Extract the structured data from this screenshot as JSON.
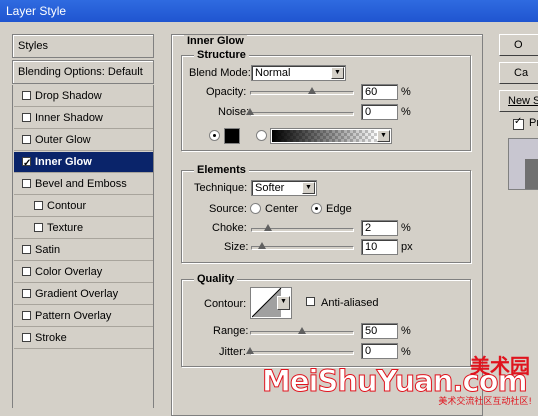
{
  "window": {
    "title": "Layer Style"
  },
  "left_panel": {
    "styles_label": "Styles",
    "blending_label": "Blending Options: Default",
    "items": [
      {
        "label": "Drop Shadow",
        "checked": false,
        "indent": false
      },
      {
        "label": "Inner Shadow",
        "checked": false,
        "indent": false
      },
      {
        "label": "Outer Glow",
        "checked": false,
        "indent": false
      },
      {
        "label": "Inner Glow",
        "checked": true,
        "indent": false,
        "selected": true
      },
      {
        "label": "Bevel and Emboss",
        "checked": false,
        "indent": false
      },
      {
        "label": "Contour",
        "checked": false,
        "indent": true
      },
      {
        "label": "Texture",
        "checked": false,
        "indent": true
      },
      {
        "label": "Satin",
        "checked": false,
        "indent": false
      },
      {
        "label": "Color Overlay",
        "checked": false,
        "indent": false
      },
      {
        "label": "Gradient Overlay",
        "checked": false,
        "indent": false
      },
      {
        "label": "Pattern Overlay",
        "checked": false,
        "indent": false
      },
      {
        "label": "Stroke",
        "checked": false,
        "indent": false
      }
    ]
  },
  "inner_glow": {
    "title": "Inner Glow",
    "structure": {
      "title": "Structure",
      "blend_mode_label": "Blend Mode:",
      "blend_mode_value": "Normal",
      "opacity_label": "Opacity:",
      "opacity_value": "60",
      "opacity_unit": "%",
      "opacity_level": 0.6,
      "noise_label": "Noise:",
      "noise_value": "0",
      "noise_unit": "%",
      "noise_level": 0,
      "color_swatch": "#000000"
    },
    "elements": {
      "title": "Elements",
      "technique_label": "Technique:",
      "technique_value": "Softer",
      "source_label": "Source:",
      "source_center": "Center",
      "source_edge": "Edge",
      "choke_label": "Choke:",
      "choke_value": "2",
      "choke_unit": "%",
      "choke_level": 0.02,
      "size_label": "Size:",
      "size_value": "10",
      "size_unit": "px",
      "size_level": 0.04
    },
    "quality": {
      "title": "Quality",
      "contour_label": "Contour:",
      "anti_aliased_label": "Anti-aliased",
      "range_label": "Range:",
      "range_value": "50",
      "range_unit": "%",
      "range_level": 0.5,
      "jitter_label": "Jitter:",
      "jitter_value": "0",
      "jitter_unit": "%",
      "jitter_level": 0
    }
  },
  "buttons": {
    "ok": "O",
    "cancel": "Ca",
    "new_style": "New S"
  },
  "preview_label": "Pr",
  "watermark": {
    "brand_cn": "美术园",
    "brand": "MeiShuYuan.com",
    "slogan": "美术交流社区互动社区!"
  },
  "colors": {
    "title_bar": "#1f55d0",
    "selection": "#0a246a",
    "watermark_red": "#e0141e"
  }
}
